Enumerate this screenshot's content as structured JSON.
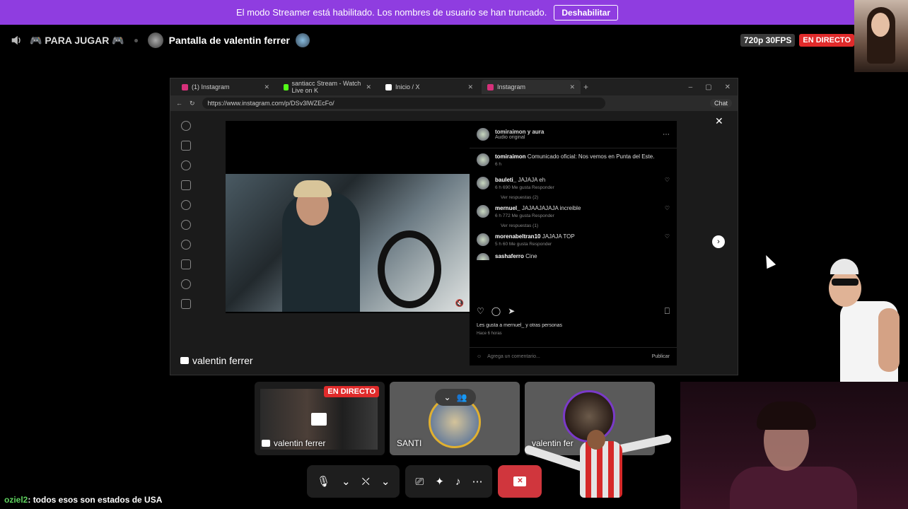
{
  "banner": {
    "message": "El modo Streamer está habilitado. Los nombres de usuario se han truncado.",
    "button": "Deshabilitar"
  },
  "header": {
    "channel": "🎮 PARA JUGAR 🎮",
    "stream_title": "Pantalla de valentin ferrer",
    "quality": "720p 30FPS",
    "live": "EN DIRECTO"
  },
  "browser": {
    "tabs": [
      {
        "label": "(1) Instagram",
        "color": "#d6307a"
      },
      {
        "label": "santiacc Stream - Watch Live on K",
        "color": "#53fc18"
      },
      {
        "label": "Inicio / X",
        "color": "#ffffff"
      },
      {
        "label": "Instagram",
        "color": "#d6307a"
      }
    ],
    "url": "https://www.instagram.com/p/DSv3lWZEcFo/",
    "chat_button": "Chat"
  },
  "instagram": {
    "header": {
      "name": "tomiraimon y aura",
      "sub": "Audio original"
    },
    "comments": [
      {
        "user": "tomiraimon",
        "text": "Comunicado oficial: Nos vemos en Punta del Este.",
        "meta": "6 h"
      },
      {
        "user": "bauleti_",
        "text": "JAJAJA eh",
        "meta": "6 h   690 Me gusta   Responder",
        "replies": "Ver respuestas (2)"
      },
      {
        "user": "mernuel_",
        "text": "JAJAAJAJAJA increible",
        "meta": "6 h   772 Me gusta   Responder",
        "replies": "Ver respuestas (1)"
      },
      {
        "user": "morenabeltran10",
        "text": "JAJAJA TOP",
        "meta": "5 h   60 Me gusta   Responder"
      },
      {
        "user": "sashaferro",
        "text": "Cine"
      }
    ],
    "likes": "Les gusta a mernuel_ y otras personas",
    "time": "Hace 6 horas",
    "comment_placeholder": "Agrega un comentario...",
    "publish": "Publicar"
  },
  "share_label": "valentin ferrer",
  "tiles": [
    {
      "label": "valentin ferrer",
      "badge": "EN DIRECTO"
    },
    {
      "label": "SANTI"
    },
    {
      "label": "valentin fer"
    }
  ],
  "chat": {
    "user": "oziel2",
    "message": ": todos esos son estados de USA"
  },
  "colors": {
    "banner": "#8f3de0",
    "live": "#e02b2b",
    "end_call": "#d0363d",
    "chat_user": "#5fd35f"
  }
}
